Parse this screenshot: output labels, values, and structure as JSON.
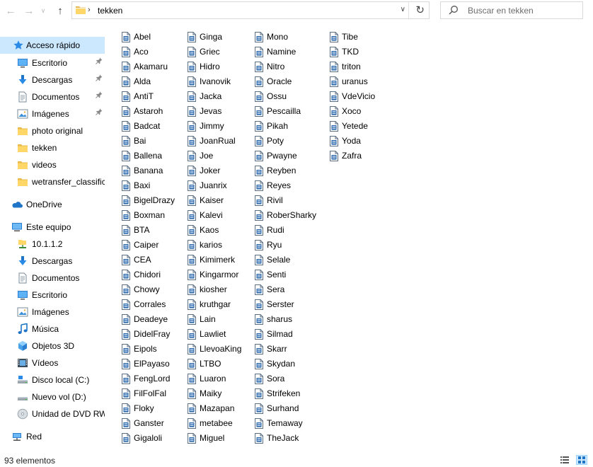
{
  "address": {
    "path": "tekken"
  },
  "search": {
    "placeholder": "Buscar en tekken"
  },
  "nav": {
    "quick_access": "Acceso rápido",
    "quick_items": [
      {
        "label": "Escritorio",
        "icon": "desktop-icon",
        "pinned": true
      },
      {
        "label": "Descargas",
        "icon": "download-icon",
        "pinned": true
      },
      {
        "label": "Documentos",
        "icon": "documents-icon",
        "pinned": true
      },
      {
        "label": "Imágenes",
        "icon": "pictures-icon",
        "pinned": true
      },
      {
        "label": "photo original",
        "icon": "folder-icon",
        "pinned": false
      },
      {
        "label": "tekken",
        "icon": "folder-icon",
        "pinned": false
      },
      {
        "label": "videos",
        "icon": "folder-icon",
        "pinned": false
      },
      {
        "label": "wetransfer_classifica",
        "icon": "folder-icon",
        "pinned": false
      }
    ],
    "onedrive": "OneDrive",
    "this_pc": "Este equipo",
    "pc_items": [
      {
        "label": "10.1.1.2",
        "icon": "network-drive-icon"
      },
      {
        "label": "Descargas",
        "icon": "download-icon"
      },
      {
        "label": "Documentos",
        "icon": "documents-icon"
      },
      {
        "label": "Escritorio",
        "icon": "desktop-icon"
      },
      {
        "label": "Imágenes",
        "icon": "pictures-icon"
      },
      {
        "label": "Música",
        "icon": "music-icon"
      },
      {
        "label": "Objetos 3D",
        "icon": "3d-objects-icon"
      },
      {
        "label": "Vídeos",
        "icon": "videos-icon"
      },
      {
        "label": "Disco local (C:)",
        "icon": "local-disk-icon"
      },
      {
        "label": "Nuevo vol (D:)",
        "icon": "drive-icon"
      },
      {
        "label": "Unidad de DVD RW",
        "icon": "dvd-drive-icon"
      }
    ],
    "network": "Red"
  },
  "files": [
    [
      "Abel",
      "Aco",
      "Akamaru",
      "Alda",
      "AntiT",
      "Astaroh",
      "Badcat",
      "Bai",
      "Ballena",
      "Banana",
      "Baxi",
      "BigelDrazy",
      "Boxman",
      "BTA",
      "Caiper",
      "CEA",
      "Chidori",
      "Chowy",
      "Corrales",
      "Deadeye",
      "DidelFray",
      "Eipols",
      "ElPayaso",
      "FengLord",
      "FilFolFal",
      "Floky",
      "Ganster",
      "Gigaloli"
    ],
    [
      "Ginga",
      "Griec",
      "Hidro",
      "Ivanovik",
      "Jacka",
      "Jevas",
      "Jimmy",
      "JoanRual",
      "Joe",
      "Joker",
      "Juanrix",
      "Kaiser",
      "Kalevi",
      "Kaos",
      "karios",
      "Kimimerk",
      "Kingarmor",
      "kiosher",
      "kruthgar",
      "Lain",
      "Lawliet",
      "LlevoaKing",
      "LTBO",
      "Luaron",
      "Maiky",
      "Mazapan",
      "metabee",
      "Miguel"
    ],
    [
      "Mono",
      "Namine",
      "Nitro",
      "Oracle",
      "Ossu",
      "Pescailla",
      "Pikah",
      "Poty",
      "Pwayne",
      "Reyben",
      "Reyes",
      "Rivil",
      "RoberSharky",
      "Rudi",
      "Ryu",
      "Selale",
      "Senti",
      "Sera",
      "Serster",
      "sharus",
      "Silmad",
      "Skarr",
      "Skydan",
      "Sora",
      "Strifeken",
      "Surhand",
      "Temaway",
      "TheJack"
    ],
    [
      "Tibe",
      "TKD",
      "triton",
      "uranus",
      "VdeVicio",
      "Xoco",
      "Yetede",
      "Yoda",
      "Zafra"
    ]
  ],
  "status": {
    "count": "93 elementos"
  }
}
